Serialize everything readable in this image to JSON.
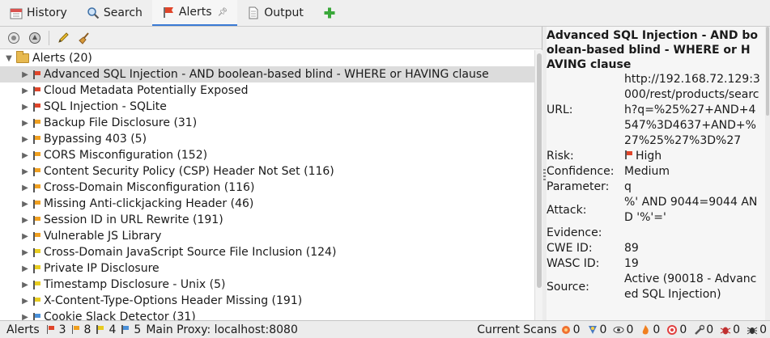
{
  "tabs": [
    {
      "label": "History",
      "icon": "calendar-icon"
    },
    {
      "label": "Search",
      "icon": "search-icon"
    },
    {
      "label": "Alerts",
      "icon": "flag-icon"
    },
    {
      "label": "Output",
      "icon": "document-icon"
    }
  ],
  "add_tab_icon": "plus-icon",
  "alerts_tree": {
    "root_label": "Alerts (20)",
    "items": [
      {
        "label": "Advanced SQL Injection - AND boolean-based blind - WHERE or HAVING clause",
        "risk": "high"
      },
      {
        "label": "Cloud Metadata Potentially Exposed",
        "risk": "high"
      },
      {
        "label": "SQL Injection - SQLite",
        "risk": "high"
      },
      {
        "label": "Backup File Disclosure (31)",
        "risk": "medium"
      },
      {
        "label": "Bypassing 403 (5)",
        "risk": "medium"
      },
      {
        "label": "CORS Misconfiguration (152)",
        "risk": "medium"
      },
      {
        "label": "Content Security Policy (CSP) Header Not Set (116)",
        "risk": "medium"
      },
      {
        "label": "Cross-Domain Misconfiguration (116)",
        "risk": "medium"
      },
      {
        "label": "Missing Anti-clickjacking Header (46)",
        "risk": "medium"
      },
      {
        "label": "Session ID in URL Rewrite (191)",
        "risk": "medium"
      },
      {
        "label": "Vulnerable JS Library",
        "risk": "medium"
      },
      {
        "label": "Cross-Domain JavaScript Source File Inclusion (124)",
        "risk": "low"
      },
      {
        "label": "Private IP Disclosure",
        "risk": "low"
      },
      {
        "label": "Timestamp Disclosure - Unix (5)",
        "risk": "low"
      },
      {
        "label": "X-Content-Type-Options Header Missing (191)",
        "risk": "low"
      },
      {
        "label": "Cookie Slack Detector (31)",
        "risk": "informational"
      }
    ]
  },
  "risk_colors": {
    "high": "#e0452a",
    "medium": "#f0a020",
    "low": "#e8cc20",
    "informational": "#4a90d9"
  },
  "details": {
    "title": "Advanced SQL Injection - AND boolean-based blind - WHERE or HAVING clause",
    "rows": [
      {
        "label": "URL:",
        "value": "http://192.168.72.129:3000/rest/products/search?q=%25%27+AND+4547%3D4637+AND+%27%25%27%3D%27"
      },
      {
        "label": "Risk:",
        "value": "High"
      },
      {
        "label": "Confidence:",
        "value": "Medium"
      },
      {
        "label": "Parameter:",
        "value": "q"
      },
      {
        "label": "Attack:",
        "value": "%' AND 9044=9044 AND '%'='"
      },
      {
        "label": "Evidence:",
        "value": ""
      },
      {
        "label": "CWE ID:",
        "value": "89"
      },
      {
        "label": "WASC ID:",
        "value": "19"
      },
      {
        "label": "Source:",
        "value": "Active (90018 - Advanced SQL Injection)"
      }
    ]
  },
  "footer": {
    "alerts_label": "Alerts",
    "high_count": "3",
    "medium_count": "8",
    "low_count": "4",
    "info_count": "5",
    "proxy": "Main Proxy: localhost:8080",
    "current_scans_label": "Current Scans",
    "scan_counts": [
      "0",
      "0",
      "0",
      "0",
      "0",
      "0",
      "0",
      "0"
    ]
  }
}
